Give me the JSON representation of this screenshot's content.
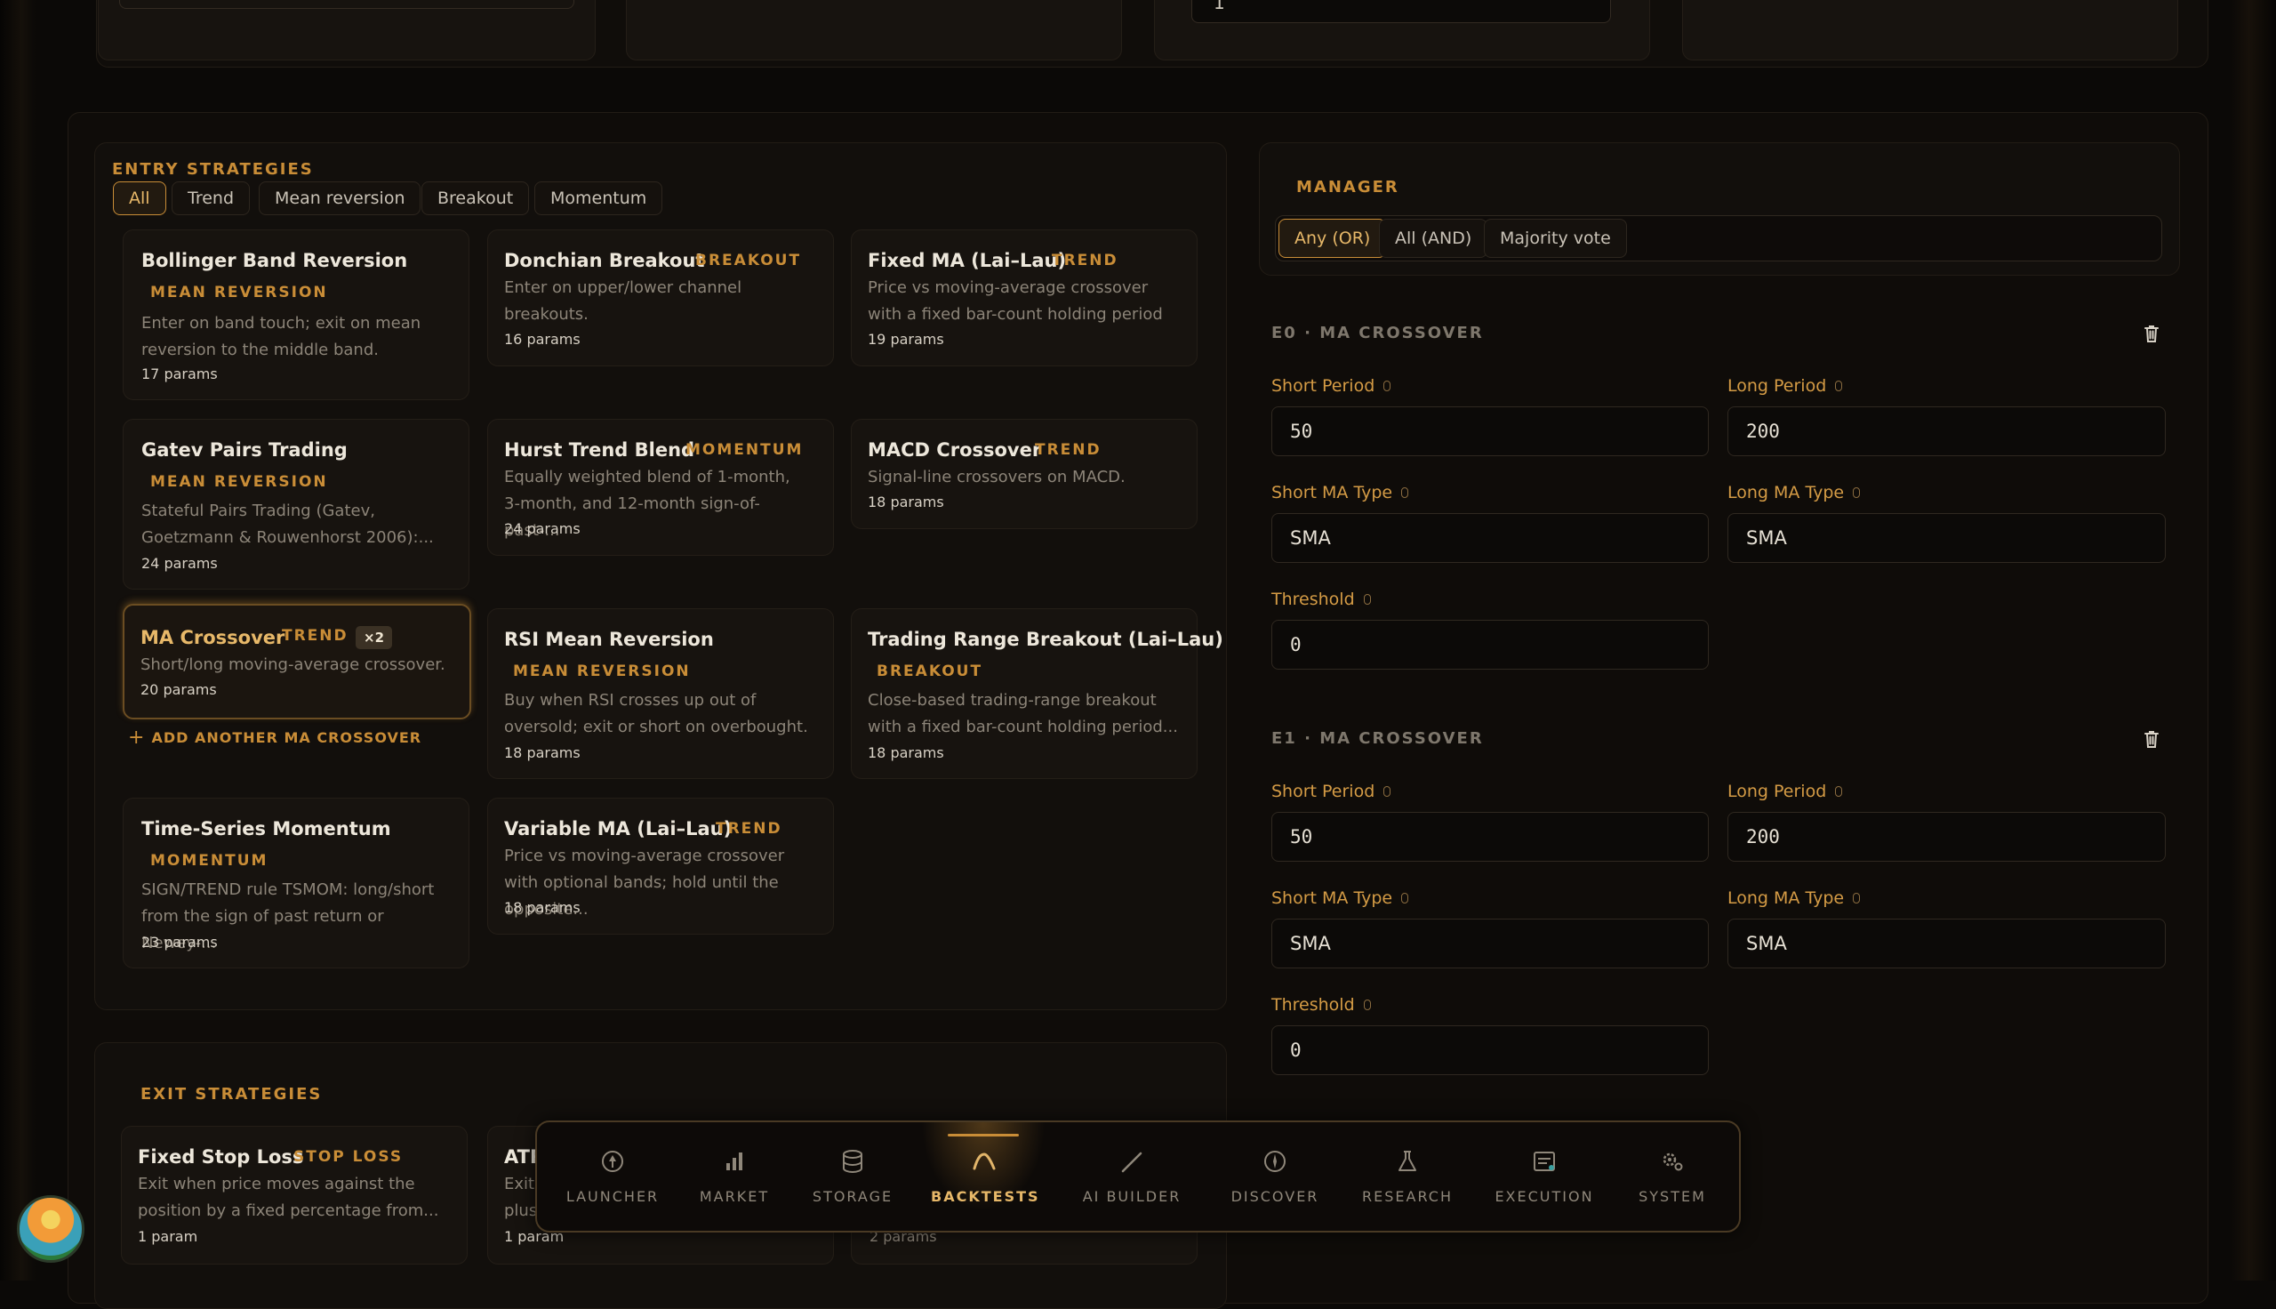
{
  "entry": {
    "heading": "ENTRY STRATEGIES",
    "filters": [
      "All",
      "Trend",
      "Mean reversion",
      "Breakout",
      "Momentum"
    ],
    "cards": [
      {
        "title": "Bollinger Band Reversion",
        "tag": "MEAN REVERSION",
        "desc": "Enter on band touch; exit on mean reversion to the middle band.",
        "params": "17 params"
      },
      {
        "title": "Donchian Breakout",
        "tag": "BREAKOUT",
        "desc": "Enter on upper/lower channel breakouts.",
        "params": "16 params"
      },
      {
        "title": "Fixed MA (Lai–Lau)",
        "tag": "TREND",
        "desc": "Price vs moving-average crossover with a fixed bar-count holding period (Lai &...",
        "params": "19 params"
      },
      {
        "title": "Gatev Pairs Trading",
        "tag": "MEAN REVERSION",
        "desc": "Stateful Pairs Trading (Gatev, Goetzmann & Rouwenhorst 2006):...",
        "params": "24 params"
      },
      {
        "title": "Hurst Trend Blend",
        "tag": "MOMENTUM",
        "desc": "Equally weighted blend of 1-month, 3-month, and 12-month sign-of-past-...",
        "params": "24 params"
      },
      {
        "title": "MACD Crossover",
        "tag": "TREND",
        "desc": "Signal-line crossovers on MACD.",
        "params": "18 params"
      },
      {
        "title": "MA Crossover",
        "tag": "TREND",
        "badge": "×2",
        "desc": "Short/long moving-average crossover.",
        "params": "20 params"
      },
      {
        "title": "RSI Mean Reversion",
        "tag": "MEAN REVERSION",
        "desc": "Buy when RSI crosses up out of oversold; exit or short on overbought.",
        "params": "18 params"
      },
      {
        "title": "Trading Range Breakout (Lai–Lau)",
        "tag": "BREAKOUT",
        "desc": "Close-based trading-range breakout with a fixed bar-count holding period...",
        "params": "18 params"
      },
      {
        "title": "Time-Series Momentum",
        "tag": "MOMENTUM",
        "desc": "SIGN/TREND rule TSMOM: long/short from the sign of past return or Newey-...",
        "params": "23 params"
      },
      {
        "title": "Variable MA (Lai–Lau)",
        "tag": "TREND",
        "desc": "Price vs moving-average crossover with optional bands; hold until the opposite...",
        "params": "18 params"
      }
    ],
    "add_another": "ADD ANOTHER MA CROSSOVER"
  },
  "exit": {
    "heading": "EXIT STRATEGIES",
    "cards": [
      {
        "title": "Fixed Stop Loss",
        "tag": "STOP LOSS",
        "desc": "Exit when price moves against the position by a fixed percentage from...",
        "params": "1 param"
      },
      {
        "title": "ATR",
        "desc1": "Exit",
        "desc2": "plus",
        "params": "1 param"
      },
      {
        "params": "2 params"
      }
    ]
  },
  "manager": {
    "heading": "MANAGER",
    "modes": [
      "Any (OR)",
      "All (AND)",
      "Majority vote"
    ],
    "active_mode": "Any (OR)",
    "entries": [
      {
        "header": "E0 · MA CROSSOVER",
        "short_period_label": "Short Period",
        "short_period": "50",
        "long_period_label": "Long Period",
        "long_period": "200",
        "short_type_label": "Short MA Type",
        "short_type": "SMA",
        "long_type_label": "Long MA Type",
        "long_type": "SMA",
        "threshold_label": "Threshold",
        "threshold": "0"
      },
      {
        "header": "E1 · MA CROSSOVER",
        "short_period_label": "Short Period",
        "short_period": "50",
        "long_period_label": "Long Period",
        "long_period": "200",
        "short_type_label": "Short MA Type",
        "short_type": "SMA",
        "long_type_label": "Long MA Type",
        "long_type": "SMA",
        "threshold_label": "Threshold",
        "threshold": "0"
      }
    ]
  },
  "top": {
    "input_value": "1"
  },
  "nav": {
    "items": [
      "LAUNCHER",
      "MARKET",
      "STORAGE",
      "BACKTESTS",
      "AI BUILDER",
      "DISCOVER",
      "RESEARCH",
      "EXECUTION",
      "SYSTEM"
    ],
    "active": "BACKTESTS"
  },
  "colors": {
    "accent": "#c98d37",
    "background": "#0b0907",
    "panel": "#120f0c",
    "card": "#17130f"
  }
}
